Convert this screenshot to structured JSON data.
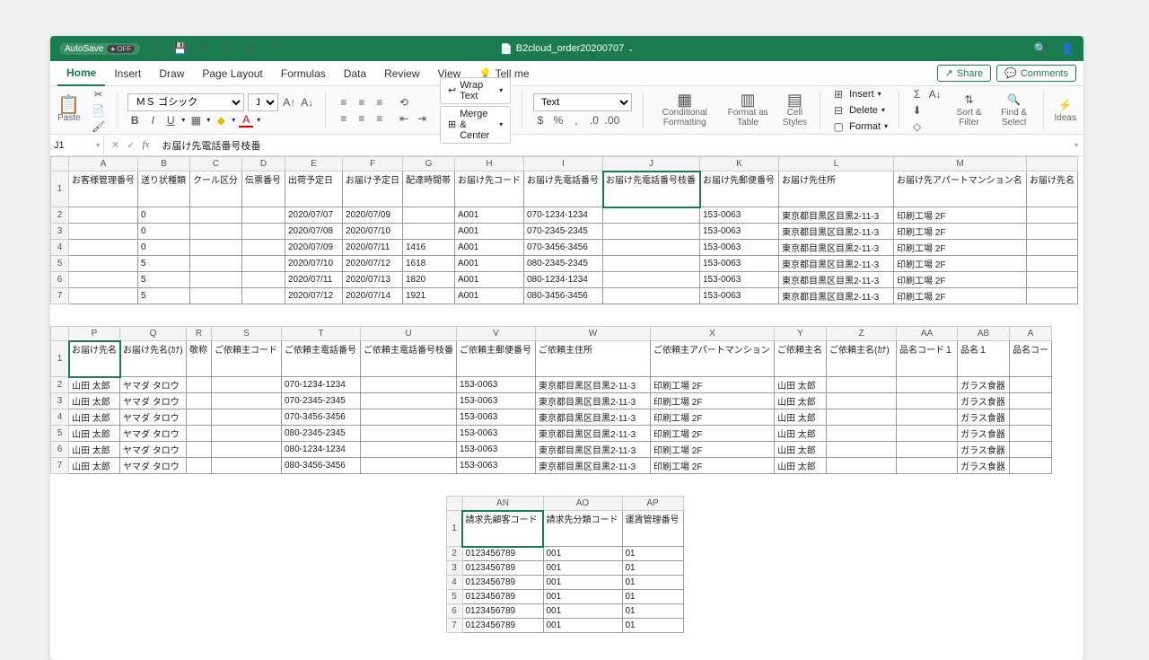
{
  "titlebar": {
    "autosave": "AutoSave",
    "off": "● OFF",
    "filename": "B2cloud_order20200707"
  },
  "tabs": {
    "items": [
      "Home",
      "Insert",
      "Draw",
      "Page Layout",
      "Formulas",
      "Data",
      "Review",
      "View"
    ],
    "tellme": "Tell me",
    "share": "Share",
    "comments": "Comments"
  },
  "ribbon": {
    "paste": "Paste",
    "font": "ＭＳ ゴシック",
    "size": "11",
    "wrap": "Wrap Text",
    "merge": "Merge & Center",
    "numfmt": "Text",
    "cond": "Conditional Formatting",
    "fastable": "Format as Table",
    "cellstyles": "Cell Styles",
    "insert": "Insert",
    "delete": "Delete",
    "format": "Format",
    "sortfilter": "Sort & Filter",
    "findselect": "Find & Select",
    "ideas": "Ideas"
  },
  "formula": {
    "cell": "J1",
    "text": "お届け先電話番号枝番"
  },
  "grid1": {
    "cols": [
      "A",
      "B",
      "C",
      "D",
      "E",
      "F",
      "G",
      "H",
      "I",
      "J",
      "K",
      "L",
      "M",
      ""
    ],
    "headers": [
      "お客様管理番号",
      "送り状種類",
      "クール区分",
      "伝票番号",
      "出荷予定日",
      "お届け予定日",
      "配達時間帯",
      "お届け先コード",
      "お届け先電話番号",
      "お届け先電話番号枝番",
      "お届け先郵便番号",
      "お届け先住所",
      "お届け先アパートマンション名",
      "お届け先名"
    ],
    "rows": [
      [
        "",
        "0",
        "",
        "",
        "2020/07/07",
        "2020/07/09",
        "",
        "A001",
        "070-1234-1234",
        "",
        "153-0063",
        "東京都目黒区目黒2-11-3",
        "印刷工場 2F",
        ""
      ],
      [
        "",
        "0",
        "",
        "",
        "2020/07/08",
        "2020/07/10",
        "",
        "A001",
        "070-2345-2345",
        "",
        "153-0063",
        "東京都目黒区目黒2-11-3",
        "印刷工場 2F",
        ""
      ],
      [
        "",
        "0",
        "",
        "",
        "2020/07/09",
        "2020/07/11",
        "1416",
        "A001",
        "070-3456-3456",
        "",
        "153-0063",
        "東京都目黒区目黒2-11-3",
        "印刷工場 2F",
        ""
      ],
      [
        "",
        "5",
        "",
        "",
        "2020/07/10",
        "2020/07/12",
        "1618",
        "A001",
        "080-2345-2345",
        "",
        "153-0063",
        "東京都目黒区目黒2-11-3",
        "印刷工場 2F",
        ""
      ],
      [
        "",
        "5",
        "",
        "",
        "2020/07/11",
        "2020/07/13",
        "1820",
        "A001",
        "080-1234-1234",
        "",
        "153-0063",
        "東京都目黒区目黒2-11-3",
        "印刷工場 2F",
        ""
      ],
      [
        "",
        "5",
        "",
        "",
        "2020/07/12",
        "2020/07/14",
        "1921",
        "A001",
        "080-3456-3456",
        "",
        "153-0063",
        "東京都目黒区目黒2-11-3",
        "印刷工場 2F",
        ""
      ]
    ]
  },
  "grid2": {
    "cols": [
      "P",
      "Q",
      "R",
      "S",
      "T",
      "U",
      "V",
      "W",
      "X",
      "Y",
      "Z",
      "AA",
      "AB",
      "A"
    ],
    "headers": [
      "お届け先名",
      "お届け先名(ｶﾅ)",
      "敬称",
      "ご依頼主コード",
      "ご依頼主電話番号",
      "ご依頼主電話番号枝番",
      "ご依頼主郵便番号",
      "ご依頼主住所",
      "ご依頼主アパートマンション",
      "ご依頼主名",
      "ご依頼主名(ｶﾅ)",
      "品名コード１",
      "品名１",
      "品名コー"
    ],
    "rows": [
      [
        "山田 太郎",
        "ヤマダ タロウ",
        "",
        "",
        "070-1234-1234",
        "",
        "153-0063",
        "東京都目黒区目黒2-11-3",
        "印刷工場 2F",
        "山田 太郎",
        "",
        "",
        "ガラス食器",
        ""
      ],
      [
        "山田 太郎",
        "ヤマダ タロウ",
        "",
        "",
        "070-2345-2345",
        "",
        "153-0063",
        "東京都目黒区目黒2-11-3",
        "印刷工場 2F",
        "山田 太郎",
        "",
        "",
        "ガラス食器",
        ""
      ],
      [
        "山田 太郎",
        "ヤマダ タロウ",
        "",
        "",
        "070-3456-3456",
        "",
        "153-0063",
        "東京都目黒区目黒2-11-3",
        "印刷工場 2F",
        "山田 太郎",
        "",
        "",
        "ガラス食器",
        ""
      ],
      [
        "山田 太郎",
        "ヤマダ タロウ",
        "",
        "",
        "080-2345-2345",
        "",
        "153-0063",
        "東京都目黒区目黒2-11-3",
        "印刷工場 2F",
        "山田 太郎",
        "",
        "",
        "ガラス食器",
        ""
      ],
      [
        "山田 太郎",
        "ヤマダ タロウ",
        "",
        "",
        "080-1234-1234",
        "",
        "153-0063",
        "東京都目黒区目黒2-11-3",
        "印刷工場 2F",
        "山田 太郎",
        "",
        "",
        "ガラス食器",
        ""
      ],
      [
        "山田 太郎",
        "ヤマダ タロウ",
        "",
        "",
        "080-3456-3456",
        "",
        "153-0063",
        "東京都目黒区目黒2-11-3",
        "印刷工場 2F",
        "山田 太郎",
        "",
        "",
        "ガラス食器",
        ""
      ]
    ]
  },
  "grid3": {
    "cols": [
      "AN",
      "AO",
      "AP"
    ],
    "headers": [
      "請求先顧客コード",
      "請求先分類コード",
      "運賃管理番号"
    ],
    "rows": [
      [
        "0123456789",
        "001",
        "01"
      ],
      [
        "0123456789",
        "001",
        "01"
      ],
      [
        "0123456789",
        "001",
        "01"
      ],
      [
        "0123456789",
        "001",
        "01"
      ],
      [
        "0123456789",
        "001",
        "01"
      ],
      [
        "0123456789",
        "001",
        "01"
      ]
    ]
  }
}
